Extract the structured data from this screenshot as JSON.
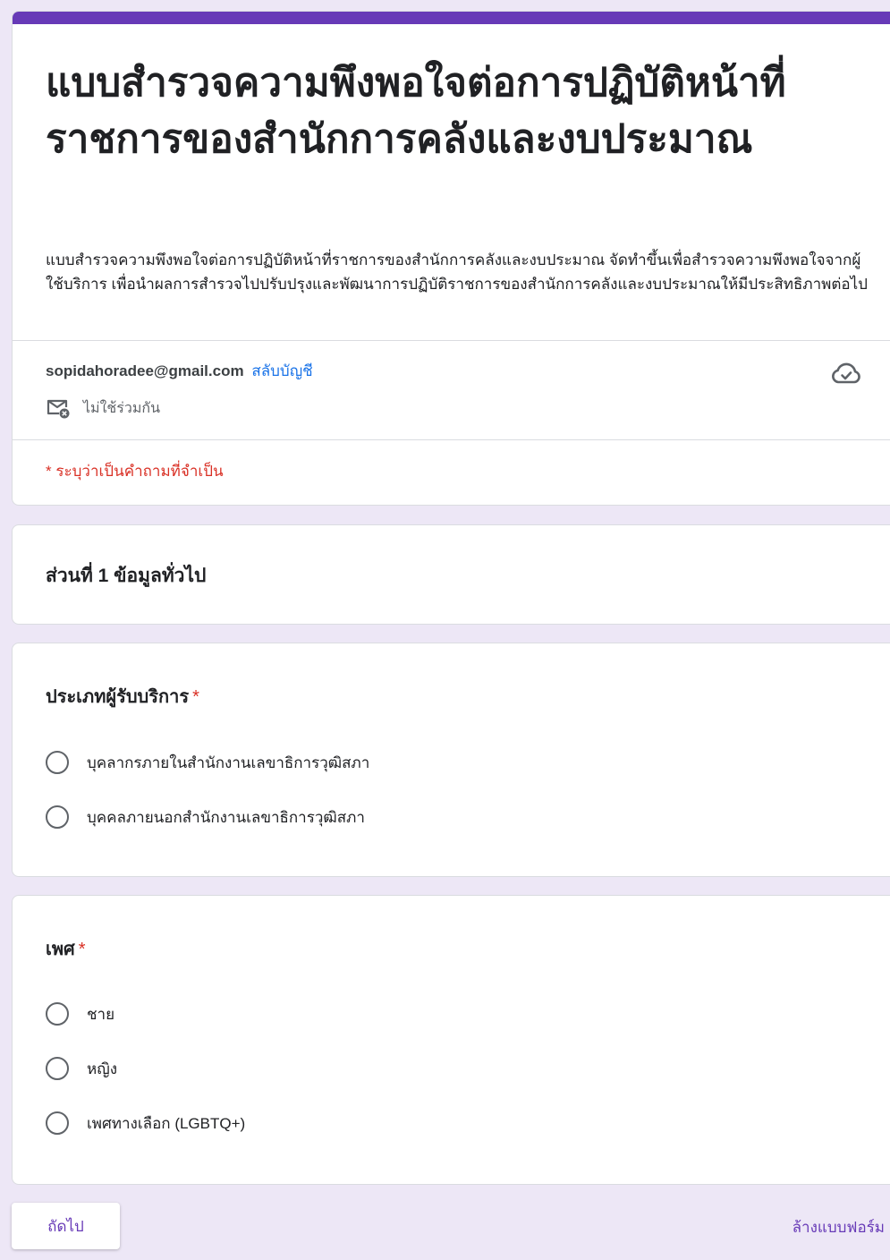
{
  "header": {
    "title": "แบบสำรวจความพึงพอใจต่อการปฏิบัติหน้าที่ราชการของสำนักการคลังและงบประมาณ",
    "description": "แบบสำรวจความพึงพอใจต่อการปฏิบัติหน้าที่ราชการของสำนักการคลังและงบประมาณ จัดทำขึ้นเพื่อสำรวจความพึงพอใจจากผู้ใช้บริการ เพื่อนำผลการสำรวจไปปรับปรุงและพัฒนาการปฏิบัติราชการของสำนักการคลังและงบประมาณให้มีประสิทธิภาพต่อไป",
    "account_email": "sopidahoradee@gmail.com",
    "switch_account_label": "สลับบัญชี",
    "not_shared_label": "ไม่ใช้ร่วมกัน",
    "required_note": "* ระบุว่าเป็นคำถามที่จำเป็น",
    "accent_color": "#673ab7",
    "icons": {
      "cloud": "cloud-saved-icon",
      "mail": "mail-not-shared-icon"
    }
  },
  "section": {
    "title": "ส่วนที่ 1 ข้อมูลทั่วไป"
  },
  "questions": [
    {
      "title": "ประเภทผู้รับบริการ",
      "required_mark": "*",
      "options": [
        "บุคลากรภายในสำนักงานเลขาธิการวุฒิสภา",
        "บุคคลภายนอกสำนักงานเลขาธิการวุฒิสภา"
      ]
    },
    {
      "title": "เพศ",
      "required_mark": "*",
      "options": [
        "ชาย",
        "หญิง",
        "เพศทางเลือก (LGBTQ+)"
      ]
    }
  ],
  "footer": {
    "next_label": "ถัดไป",
    "clear_label": "ล้างแบบฟอร์ม"
  }
}
